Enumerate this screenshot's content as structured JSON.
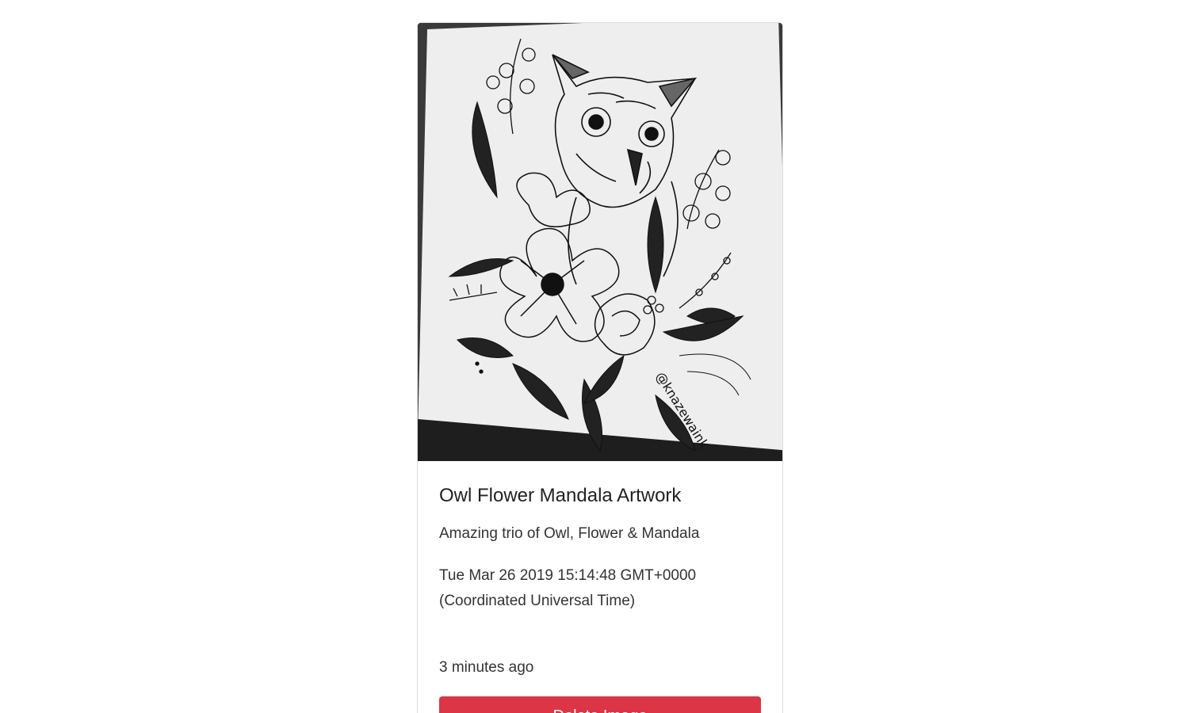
{
  "card": {
    "image_alt": "Owl flower sketch",
    "title": "Owl Flower Mandala Artwork",
    "description": "Amazing trio of Owl, Flower & Mandala",
    "date": "Tue Mar 26 2019 15:14:48 GMT+0000 (Coordinated Universal Time)",
    "relative_time": "3 minutes ago",
    "delete_label": "Delete Image",
    "delete_color": "#dc3545",
    "signature": "@knazewaink"
  }
}
